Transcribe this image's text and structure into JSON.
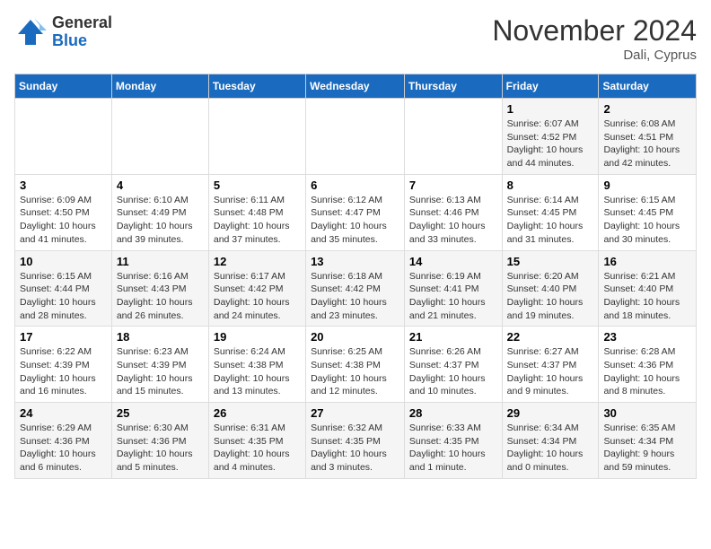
{
  "logo": {
    "general": "General",
    "blue": "Blue"
  },
  "title": "November 2024",
  "location": "Dali, Cyprus",
  "days_of_week": [
    "Sunday",
    "Monday",
    "Tuesday",
    "Wednesday",
    "Thursday",
    "Friday",
    "Saturday"
  ],
  "weeks": [
    [
      {
        "day": "",
        "info": ""
      },
      {
        "day": "",
        "info": ""
      },
      {
        "day": "",
        "info": ""
      },
      {
        "day": "",
        "info": ""
      },
      {
        "day": "",
        "info": ""
      },
      {
        "day": "1",
        "info": "Sunrise: 6:07 AM\nSunset: 4:52 PM\nDaylight: 10 hours and 44 minutes."
      },
      {
        "day": "2",
        "info": "Sunrise: 6:08 AM\nSunset: 4:51 PM\nDaylight: 10 hours and 42 minutes."
      }
    ],
    [
      {
        "day": "3",
        "info": "Sunrise: 6:09 AM\nSunset: 4:50 PM\nDaylight: 10 hours and 41 minutes."
      },
      {
        "day": "4",
        "info": "Sunrise: 6:10 AM\nSunset: 4:49 PM\nDaylight: 10 hours and 39 minutes."
      },
      {
        "day": "5",
        "info": "Sunrise: 6:11 AM\nSunset: 4:48 PM\nDaylight: 10 hours and 37 minutes."
      },
      {
        "day": "6",
        "info": "Sunrise: 6:12 AM\nSunset: 4:47 PM\nDaylight: 10 hours and 35 minutes."
      },
      {
        "day": "7",
        "info": "Sunrise: 6:13 AM\nSunset: 4:46 PM\nDaylight: 10 hours and 33 minutes."
      },
      {
        "day": "8",
        "info": "Sunrise: 6:14 AM\nSunset: 4:45 PM\nDaylight: 10 hours and 31 minutes."
      },
      {
        "day": "9",
        "info": "Sunrise: 6:15 AM\nSunset: 4:45 PM\nDaylight: 10 hours and 30 minutes."
      }
    ],
    [
      {
        "day": "10",
        "info": "Sunrise: 6:15 AM\nSunset: 4:44 PM\nDaylight: 10 hours and 28 minutes."
      },
      {
        "day": "11",
        "info": "Sunrise: 6:16 AM\nSunset: 4:43 PM\nDaylight: 10 hours and 26 minutes."
      },
      {
        "day": "12",
        "info": "Sunrise: 6:17 AM\nSunset: 4:42 PM\nDaylight: 10 hours and 24 minutes."
      },
      {
        "day": "13",
        "info": "Sunrise: 6:18 AM\nSunset: 4:42 PM\nDaylight: 10 hours and 23 minutes."
      },
      {
        "day": "14",
        "info": "Sunrise: 6:19 AM\nSunset: 4:41 PM\nDaylight: 10 hours and 21 minutes."
      },
      {
        "day": "15",
        "info": "Sunrise: 6:20 AM\nSunset: 4:40 PM\nDaylight: 10 hours and 19 minutes."
      },
      {
        "day": "16",
        "info": "Sunrise: 6:21 AM\nSunset: 4:40 PM\nDaylight: 10 hours and 18 minutes."
      }
    ],
    [
      {
        "day": "17",
        "info": "Sunrise: 6:22 AM\nSunset: 4:39 PM\nDaylight: 10 hours and 16 minutes."
      },
      {
        "day": "18",
        "info": "Sunrise: 6:23 AM\nSunset: 4:39 PM\nDaylight: 10 hours and 15 minutes."
      },
      {
        "day": "19",
        "info": "Sunrise: 6:24 AM\nSunset: 4:38 PM\nDaylight: 10 hours and 13 minutes."
      },
      {
        "day": "20",
        "info": "Sunrise: 6:25 AM\nSunset: 4:38 PM\nDaylight: 10 hours and 12 minutes."
      },
      {
        "day": "21",
        "info": "Sunrise: 6:26 AM\nSunset: 4:37 PM\nDaylight: 10 hours and 10 minutes."
      },
      {
        "day": "22",
        "info": "Sunrise: 6:27 AM\nSunset: 4:37 PM\nDaylight: 10 hours and 9 minutes."
      },
      {
        "day": "23",
        "info": "Sunrise: 6:28 AM\nSunset: 4:36 PM\nDaylight: 10 hours and 8 minutes."
      }
    ],
    [
      {
        "day": "24",
        "info": "Sunrise: 6:29 AM\nSunset: 4:36 PM\nDaylight: 10 hours and 6 minutes."
      },
      {
        "day": "25",
        "info": "Sunrise: 6:30 AM\nSunset: 4:36 PM\nDaylight: 10 hours and 5 minutes."
      },
      {
        "day": "26",
        "info": "Sunrise: 6:31 AM\nSunset: 4:35 PM\nDaylight: 10 hours and 4 minutes."
      },
      {
        "day": "27",
        "info": "Sunrise: 6:32 AM\nSunset: 4:35 PM\nDaylight: 10 hours and 3 minutes."
      },
      {
        "day": "28",
        "info": "Sunrise: 6:33 AM\nSunset: 4:35 PM\nDaylight: 10 hours and 1 minute."
      },
      {
        "day": "29",
        "info": "Sunrise: 6:34 AM\nSunset: 4:34 PM\nDaylight: 10 hours and 0 minutes."
      },
      {
        "day": "30",
        "info": "Sunrise: 6:35 AM\nSunset: 4:34 PM\nDaylight: 9 hours and 59 minutes."
      }
    ]
  ]
}
